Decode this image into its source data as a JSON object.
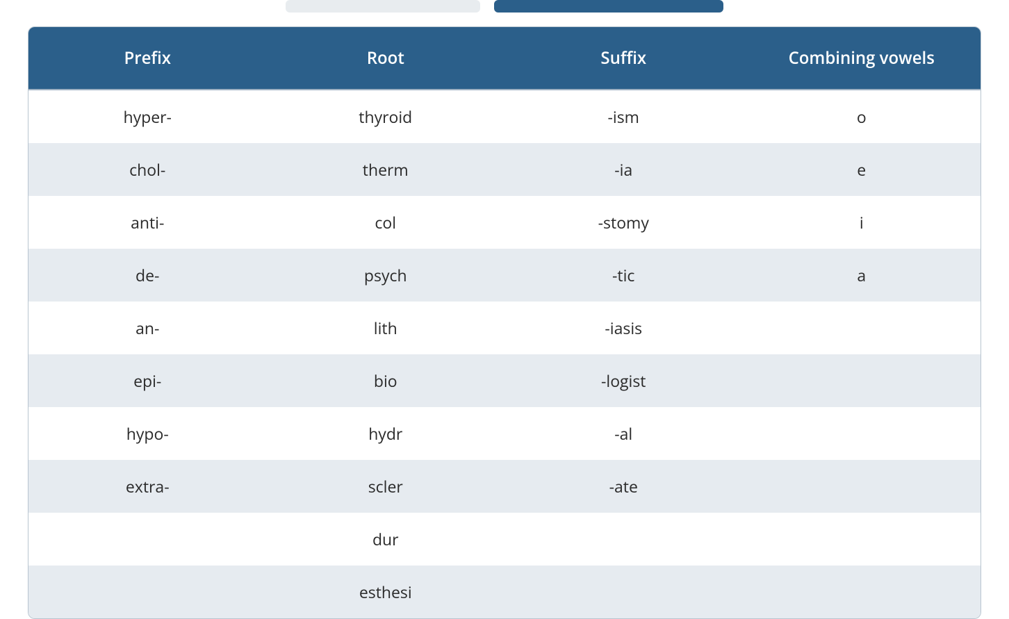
{
  "table": {
    "headers": [
      "Prefix",
      "Root",
      "Suffix",
      "Combining vowels"
    ],
    "rows": [
      {
        "prefix": "hyper-",
        "root": "thyroid",
        "suffix": "-ism",
        "vowel": "o"
      },
      {
        "prefix": "chol-",
        "root": "therm",
        "suffix": "-ia",
        "vowel": "e"
      },
      {
        "prefix": "anti-",
        "root": "col",
        "suffix": "-stomy",
        "vowel": "i"
      },
      {
        "prefix": "de-",
        "root": "psych",
        "suffix": "-tic",
        "vowel": "a"
      },
      {
        "prefix": "an-",
        "root": "lith",
        "suffix": "-iasis",
        "vowel": ""
      },
      {
        "prefix": "epi-",
        "root": "bio",
        "suffix": "-logist",
        "vowel": ""
      },
      {
        "prefix": "hypo-",
        "root": "hydr",
        "suffix": "-al",
        "vowel": ""
      },
      {
        "prefix": "extra-",
        "root": "scler",
        "suffix": "-ate",
        "vowel": ""
      },
      {
        "prefix": "",
        "root": "dur",
        "suffix": "",
        "vowel": ""
      },
      {
        "prefix": "",
        "root": "esthesi",
        "suffix": "",
        "vowel": ""
      }
    ]
  }
}
